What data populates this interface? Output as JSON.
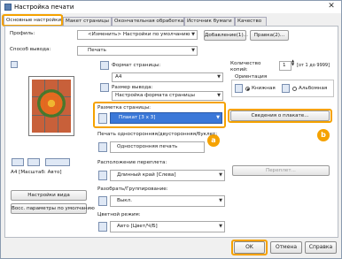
{
  "window": {
    "title": "Настройка печати",
    "close_glyph": "✕"
  },
  "tabs": [
    "Основные настройки",
    "Макет страницы",
    "Окончательная обработка",
    "Источник бумаги",
    "Качество"
  ],
  "profile": {
    "label": "Профиль:",
    "value": "<Изменить> Настройки по умолчанию",
    "add_button": "Добавление(1)...",
    "edit_button": "Правка(2)..."
  },
  "output_method": {
    "label": "Способ вывода:",
    "value": "Печать"
  },
  "preview": {
    "caption": "A4 [Масштаб: Авто]",
    "settings_button": "Настройки вида",
    "restore_button": "Восс. параметры по умолчанию"
  },
  "page_size": {
    "label": "Формат страницы:",
    "value": "A4"
  },
  "output_size": {
    "label": "Размер вывода:",
    "value": "Настройка формата страницы"
  },
  "layout": {
    "label": "Разметка страницы:",
    "value": "Плакат [3 x 3]",
    "details_button": "Сведения о плакате...",
    "badge_a": "a",
    "badge_b": "b"
  },
  "duplex": {
    "label": "Печать односторонняя/двусторонняя/буклет:",
    "value": "Односторонняя печать"
  },
  "binding": {
    "label": "Расположение переплета:",
    "value": "Длинный край [Слева]",
    "margin_button": "Переплет..."
  },
  "collate": {
    "label": "Разобрать/Группирование:",
    "value": "Выкл."
  },
  "color_mode": {
    "label": "Цветной режим:",
    "value": "Авто [Цвет/Ч/Б]"
  },
  "copies": {
    "label": "Количество копий:",
    "value": "1",
    "range": "[от 1 до 9999]"
  },
  "orientation": {
    "label": "Ориентация",
    "portrait": "Книжная",
    "landscape": "Альбомная",
    "selected": "portrait"
  },
  "footer": {
    "ok": "OK",
    "cancel": "Отмена",
    "help": "Справка"
  }
}
